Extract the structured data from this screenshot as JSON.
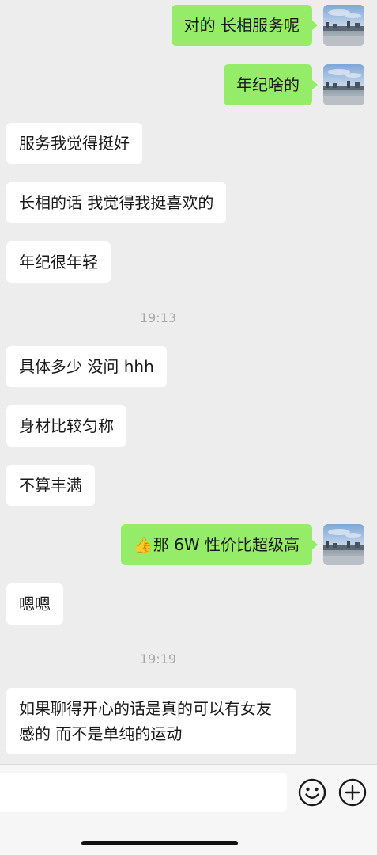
{
  "messages": [
    {
      "side": "right",
      "text": "对的 长相服务呢"
    },
    {
      "side": "right",
      "text": "年纪啥的"
    },
    {
      "side": "left",
      "text": "服务我觉得挺好"
    },
    {
      "side": "left",
      "text": "长相的话 我觉得我挺喜欢的"
    },
    {
      "side": "left",
      "text": "年纪很年轻"
    },
    {
      "type": "time",
      "text": "19:13"
    },
    {
      "side": "left",
      "text": "具体多少 没问 hhh"
    },
    {
      "side": "left",
      "text": "身材比较匀称"
    },
    {
      "side": "left",
      "text": "不算丰满"
    },
    {
      "side": "right",
      "emoji": "👍",
      "text": "那 6W 性价比超级高"
    },
    {
      "side": "left",
      "text": "嗯嗯"
    },
    {
      "type": "time",
      "text": "19:19"
    },
    {
      "side": "left",
      "text": "如果聊得开心的话是真的可以有女友感的 而不是单纯的运动"
    }
  ],
  "input_bar": {
    "input_value": "",
    "icons": [
      "emoji-icon",
      "plus-icon"
    ]
  },
  "colors": {
    "background": "#ededed",
    "outgoing_bubble": "#95ec69",
    "incoming_bubble": "#ffffff",
    "time_text": "#a6a6a6"
  }
}
